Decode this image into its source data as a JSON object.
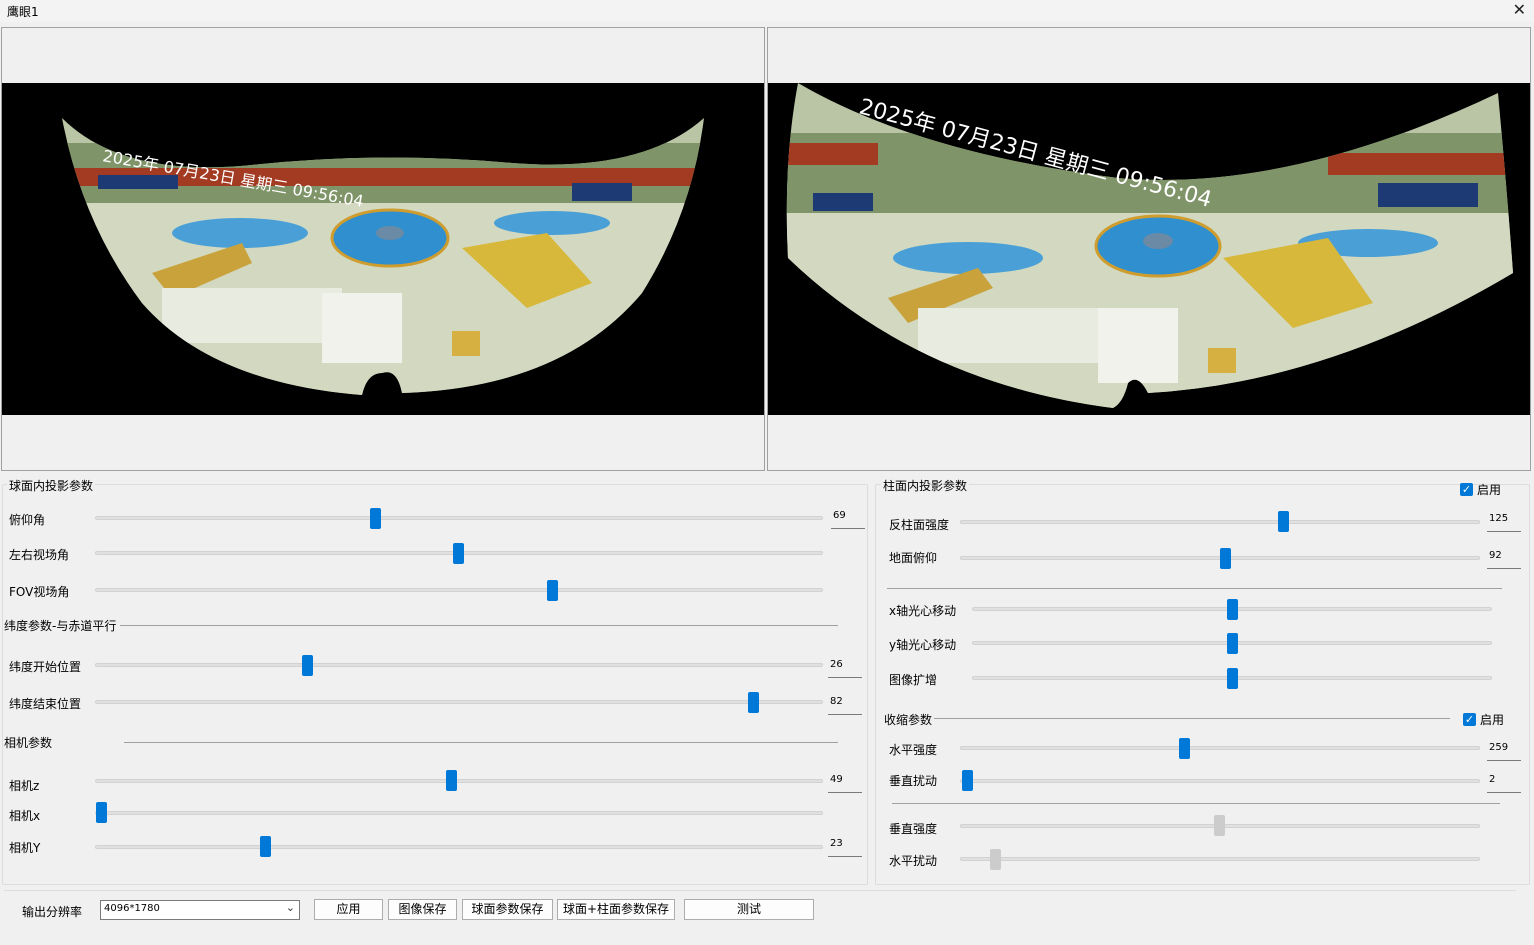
{
  "window": {
    "title": "鹰眼1",
    "close_icon": "close-icon"
  },
  "sphere": {
    "title": "球面内投影参数",
    "pitch": {
      "label": "俯仰角",
      "value": "69",
      "level": 0.38
    },
    "lr_fov": {
      "label": "左右视场角",
      "level": 0.5
    },
    "fov": {
      "label": "FOV视场角",
      "level": 0.63
    },
    "lat_group": "纬度参数-与赤道平行",
    "lat_start": {
      "label": "纬度开始位置",
      "value": "26",
      "level": 0.29
    },
    "lat_end": {
      "label": "纬度结束位置",
      "value": "82",
      "level": 0.9
    },
    "cam_group": "相机参数",
    "cam_z": {
      "label": "相机z",
      "value": "49",
      "level": 0.49
    },
    "cam_x": {
      "label": "相机x",
      "level": 0.0
    },
    "cam_y": {
      "label": "相机Y",
      "value": "23",
      "level": 0.23
    }
  },
  "cylinder": {
    "title": "柱面内投影参数",
    "enable": "启用",
    "anti": {
      "label": "反柱面强度",
      "value": "125",
      "level": 0.62
    },
    "ground": {
      "label": "地面俯仰",
      "value": "92",
      "level": 0.51
    },
    "x_move": {
      "label": "x轴光心移动",
      "level": 0.5
    },
    "y_move": {
      "label": "y轴光心移动",
      "level": 0.5
    },
    "expand": {
      "label": "图像扩增",
      "level": 0.5
    },
    "shrink_group": "收缩参数",
    "shrink_enable": "启用",
    "h_strength": {
      "label": "水平强度",
      "value": "259",
      "level": 0.43
    },
    "v_disturb": {
      "label": "垂直扰动",
      "value": "2",
      "level": 0.01
    },
    "v_strength": {
      "label": "垂直强度",
      "level": 0.5
    },
    "h_disturb": {
      "label": "水平扰动",
      "level": 0.07
    }
  },
  "bottom": {
    "resolution_label": "输出分辨率",
    "resolution_value": "4096*1780",
    "apply": "应用",
    "save_image": "图像保存",
    "save_sphere": "球面参数保存",
    "save_both": "球面+柱面参数保存",
    "test": "测试"
  },
  "images": {
    "left_overlay": "2025年 07月23日 星期三 09:56:04",
    "right_overlay": "2025年 07月23日 星期三 09:56:04"
  },
  "colors": {
    "accent": "#0078d7",
    "floor": "#d6dcc4",
    "blue_disc": "#2f8fcf",
    "yellow": "#d8b83a"
  }
}
